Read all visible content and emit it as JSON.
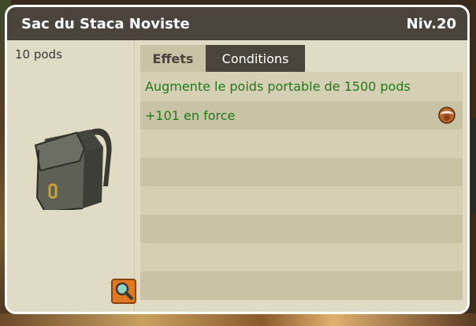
{
  "window": {
    "title": "Sac du Staca Noviste",
    "level": "Niv.20"
  },
  "item": {
    "weight": "10 pods",
    "image_icon": "backpack-icon",
    "zoom_icon": "magnifier-icon"
  },
  "tabs": [
    {
      "label": "Effets",
      "active": true
    },
    {
      "label": "Conditions",
      "active": false
    }
  ],
  "effects": [
    {
      "text": "Augmente le poids portable de 1500 pods",
      "icon": ""
    },
    {
      "text": "+101 en force",
      "icon": "strength-element-icon"
    },
    {
      "text": "",
      "icon": ""
    },
    {
      "text": "",
      "icon": ""
    },
    {
      "text": "",
      "icon": ""
    },
    {
      "text": "",
      "icon": ""
    },
    {
      "text": "",
      "icon": ""
    },
    {
      "text": "",
      "icon": ""
    }
  ],
  "colors": {
    "titlebar": "#4a443c",
    "panel": "#e0dbc4",
    "effect_text": "#217a1a",
    "zoom_button": "#e2791e"
  }
}
